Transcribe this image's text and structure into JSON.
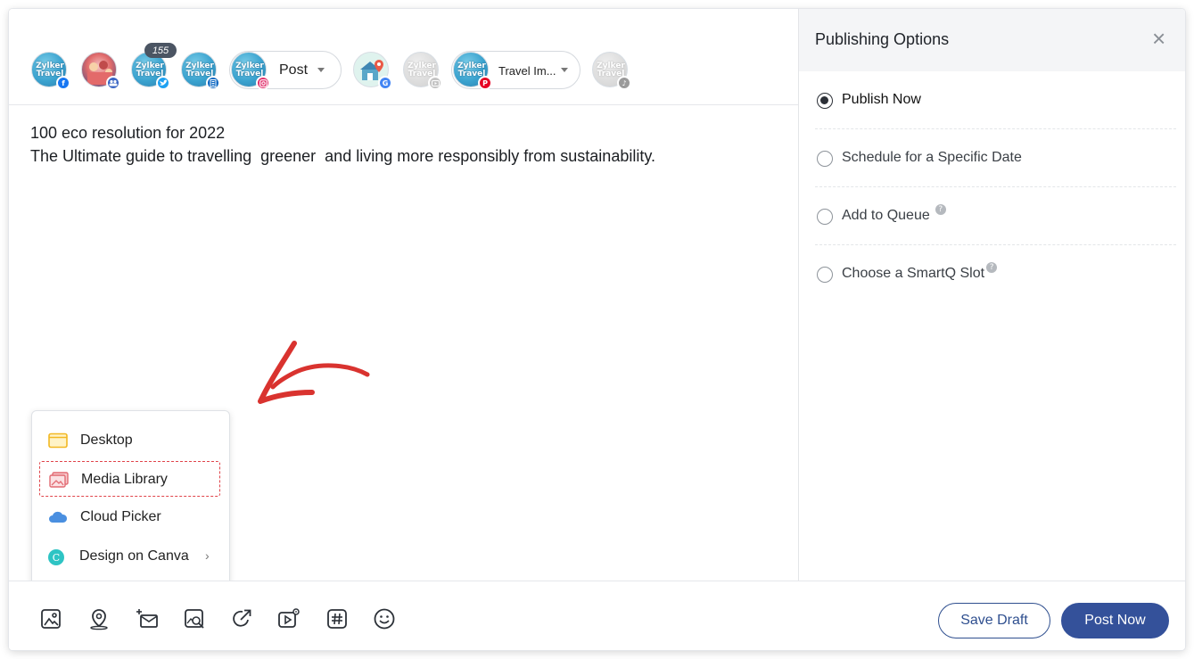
{
  "composer": {
    "accounts": [
      {
        "name": "zylker-travel-facebook",
        "logo": "Zylker Travel",
        "network": "facebook",
        "badge_color": "#1877f2",
        "active": true
      },
      {
        "name": "group-facebook",
        "logo": "",
        "network": "facebook-group",
        "badge_color": "#3b66c4",
        "active": true
      },
      {
        "name": "zylker-travel-twitter",
        "logo": "Zylker Travel",
        "network": "twitter",
        "badge_color": "#1da1f2",
        "active": true,
        "count": "155"
      },
      {
        "name": "zylker-travel-linkedin-page",
        "logo": "Zylker Travel",
        "network": "linkedin-page",
        "badge_color": "#0a66c2",
        "active": true
      },
      {
        "name": "zylker-travel-instagram",
        "logo": "Zylker Travel",
        "network": "instagram",
        "badge_color": "#e1306c",
        "active": true
      },
      {
        "name": "google-business",
        "logo": "",
        "network": "google",
        "badge_color": "#4285f4",
        "active": true
      },
      {
        "name": "zylker-travel-youtube",
        "logo": "Zylker Travel",
        "network": "youtube",
        "badge_color": "#c4c4c4",
        "active": false
      },
      {
        "name": "zylker-travel-pinterest",
        "logo": "Zylker Travel",
        "network": "pinterest",
        "badge_color": "#e60023",
        "active": true
      },
      {
        "name": "zylker-travel-tiktok",
        "logo": "Zylker Travel",
        "network": "tiktok",
        "badge_color": "#9a9a9a",
        "active": false
      }
    ],
    "instagram_type": "Post",
    "pinterest_board": "Travel Im...",
    "twitter_count": "155",
    "post_text_line1": "100 eco resolution for 2022",
    "post_text_line2": "The Ultimate guide to travelling  greener  and living more responsibly from sustainability."
  },
  "media_menu": {
    "items": [
      {
        "label": "Desktop",
        "icon": "desktop-window-icon"
      },
      {
        "label": "Media Library",
        "icon": "media-library-icon",
        "highlighted": true
      },
      {
        "label": "Cloud Picker",
        "icon": "cloud-icon"
      },
      {
        "label": "Design on Canva",
        "icon": "canva-icon",
        "has_submenu": true
      }
    ]
  },
  "toolbar": {
    "tools": [
      "image-attach-icon",
      "location-pin-icon",
      "add-email-icon",
      "image-search-icon",
      "share-link-icon",
      "video-settings-icon",
      "hashtag-icon",
      "emoji-icon"
    ],
    "save_draft": "Save Draft",
    "post_now": "Post Now"
  },
  "publishing": {
    "title": "Publishing Options",
    "options": [
      {
        "label": "Publish Now",
        "selected": true,
        "help": false
      },
      {
        "label": "Schedule for a Specific Date",
        "selected": false,
        "help": false
      },
      {
        "label": "Add to Queue",
        "selected": false,
        "help": true
      },
      {
        "label": "Choose a SmartQ Slot",
        "selected": false,
        "help": true
      }
    ]
  },
  "colors": {
    "primary": "#34519a",
    "annotation_arrow": "#d9332f",
    "highlight_border": "#e0444a"
  }
}
